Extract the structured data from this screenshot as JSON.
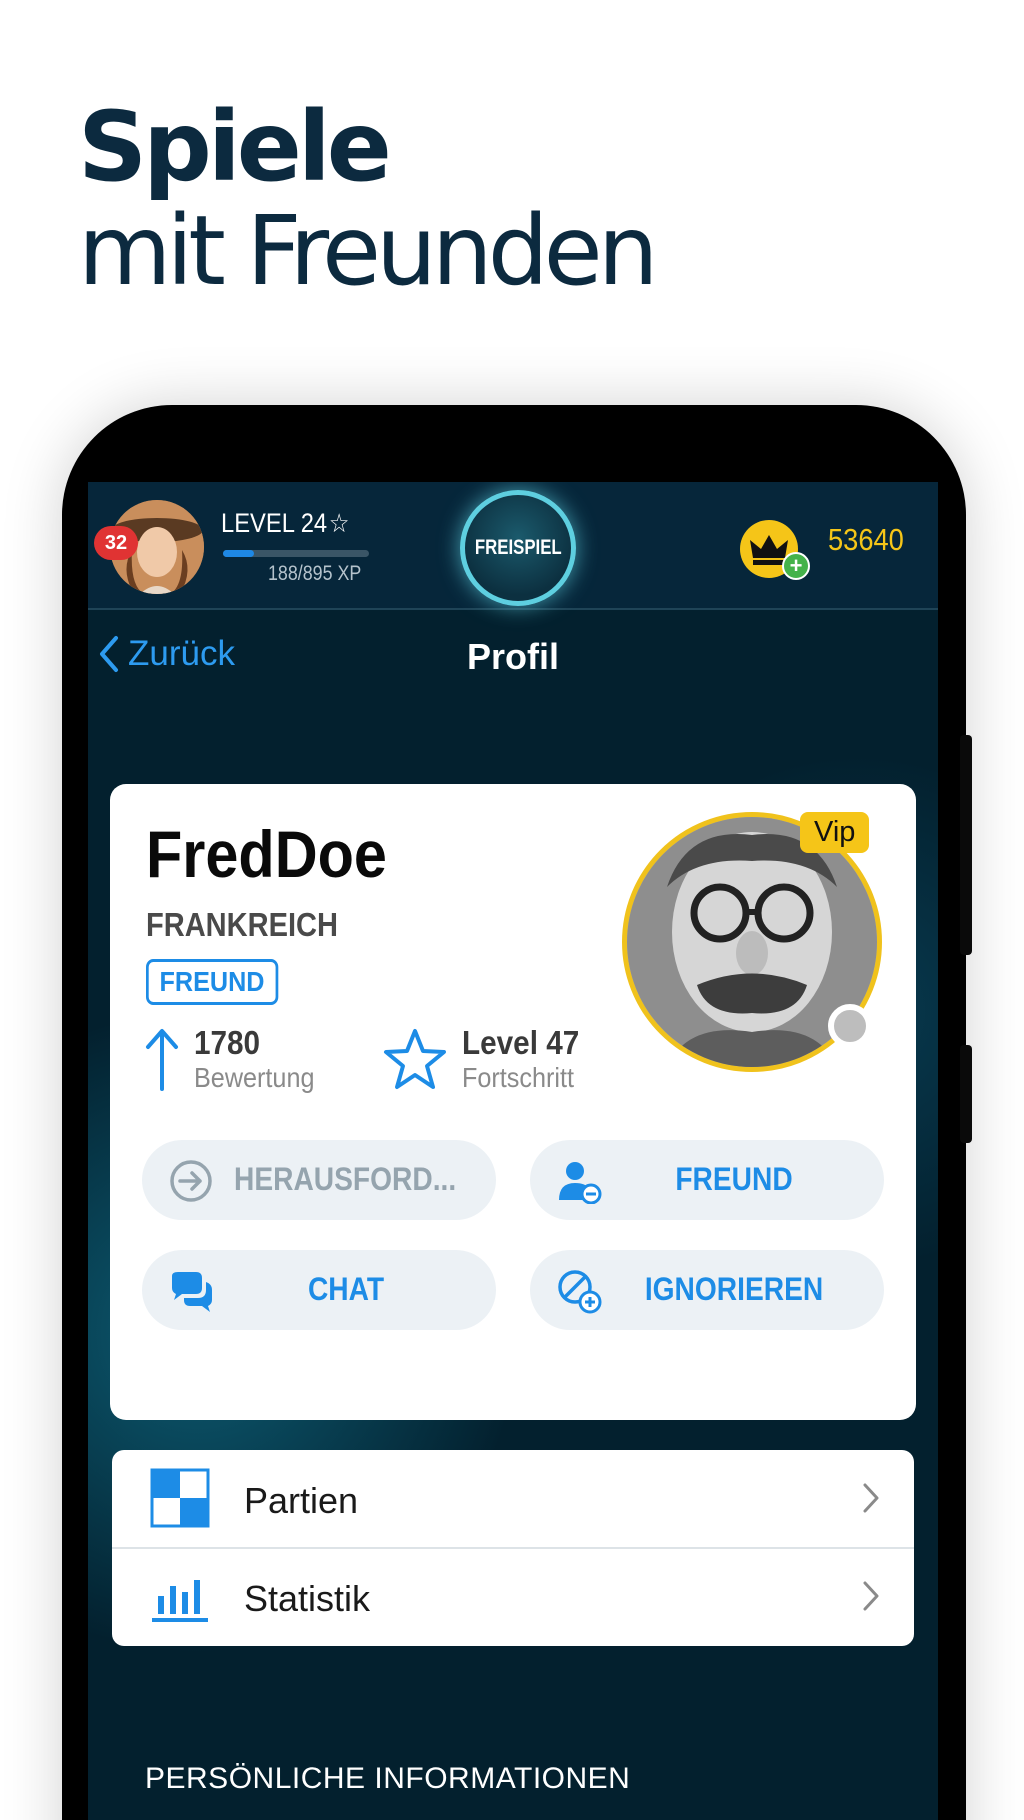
{
  "headline": {
    "line1": "Spiele",
    "line2": "mit Freunden"
  },
  "topbar": {
    "notification_count": "32",
    "level": "LEVEL 24",
    "xp_text": "188/895 XP",
    "xp_progress": 0.21,
    "freispiel": "FREISPIEL",
    "coins": "53640"
  },
  "navbar": {
    "back_label": "Zurück",
    "title": "Profil"
  },
  "profile": {
    "name": "FredDoe",
    "country": "FRANKREICH",
    "relation_tag": "FREUND",
    "vip": "Vip",
    "rating_value": "1780",
    "rating_label": "Bewertung",
    "level_value": "Level 47",
    "level_label": "Fortschritt"
  },
  "actions": {
    "challenge": "HERAUSFORD...",
    "friend": "FREUND",
    "chat": "CHAT",
    "ignore": "IGNORIEREN"
  },
  "menu": [
    {
      "label": "Partien",
      "icon": "chessboard-icon"
    },
    {
      "label": "Statistik",
      "icon": "bar-chart-icon"
    }
  ],
  "section_title": "PERSÖNLICHE INFORMATIONEN",
  "colors": {
    "accent": "#1d8ce6",
    "gold": "#f5c518",
    "background": "#03202e",
    "headline": "#0c2a3f"
  }
}
